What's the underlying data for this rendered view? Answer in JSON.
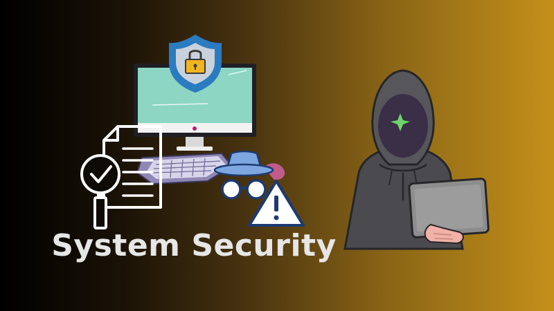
{
  "banner": {
    "title": "System Security"
  },
  "icons": {
    "shield": "shield-lock-icon",
    "monitor": "computer-monitor-icon",
    "keyboard": "keyboard-icon",
    "document": "document-check-icon",
    "magnifier": "magnifier-icon",
    "spy": "spy-agent-icon",
    "warning": "warning-triangle-icon",
    "hacker": "hooded-hacker-icon",
    "laptop": "laptop-icon"
  },
  "colors": {
    "background_left": "#000000",
    "background_right": "#c5901a",
    "shield_blue": "#2b7bc0",
    "screen_mint": "#8cd6c3",
    "hood_gray": "#4a4a4f",
    "title": "#e6e6e6"
  }
}
